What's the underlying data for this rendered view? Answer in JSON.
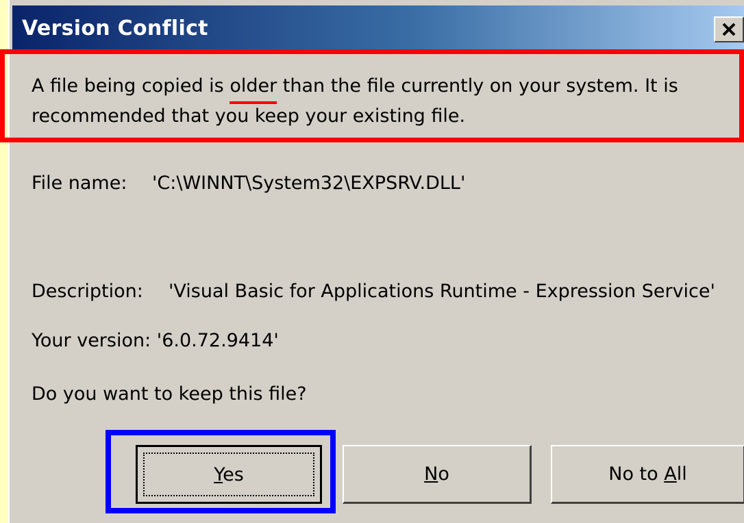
{
  "window": {
    "title": "Version Conflict",
    "close_glyph": "×"
  },
  "message": {
    "part1": "A file being copied is ",
    "emphasis": "older",
    "part2": " than the file currently on your system.  It is recommended that you keep your existing file."
  },
  "details": {
    "file_name_label": "File name:",
    "file_name_value": "'C:\\WINNT\\System32\\EXPSRV.DLL'",
    "description_label": "Description:",
    "description_value": "'Visual Basic for Applications Runtime - Expression Service'",
    "version_text": "Your version: '6.0.72.9414'"
  },
  "question": "Do you want to keep this file?",
  "buttons": {
    "yes": {
      "mnemonic": "Y",
      "rest": "es"
    },
    "no": {
      "mnemonic": "N",
      "rest": "o"
    },
    "no_to_all": {
      "prefix": "No to ",
      "mnemonic": "A",
      "rest": "ll"
    }
  },
  "annotations": {
    "message_highlight_color": "#ff0000",
    "default_button_highlight_color": "#0000ff"
  },
  "icons": {
    "close": "close-icon"
  }
}
